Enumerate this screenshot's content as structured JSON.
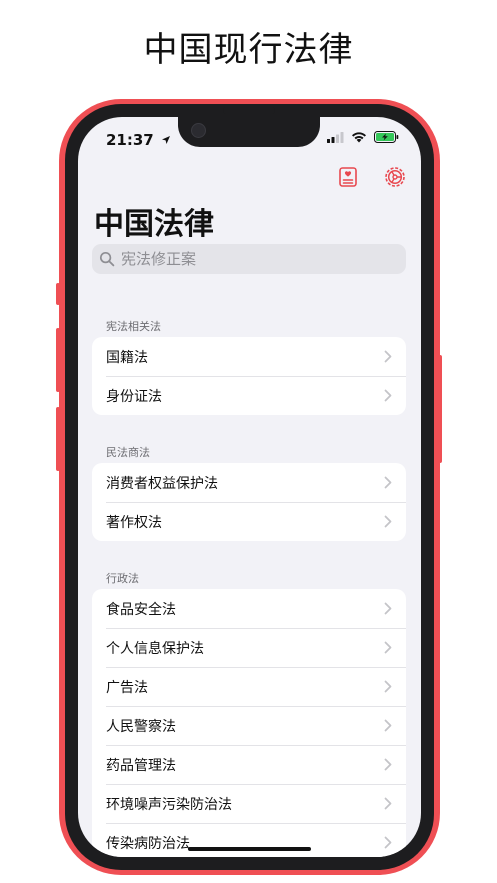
{
  "headline": "中国现行法律",
  "status_bar": {
    "time": "21:37"
  },
  "nav": {
    "title": "中国法律"
  },
  "search": {
    "placeholder": "宪法修正案"
  },
  "sections": [
    {
      "header": "宪法相关法",
      "items": [
        "国籍法",
        "身份证法"
      ]
    },
    {
      "header": "民法商法",
      "items": [
        "消费者权益保护法",
        "著作权法"
      ]
    },
    {
      "header": "行政法",
      "items": [
        "食品安全法",
        "个人信息保护法",
        "广告法",
        "人民警察法",
        "药品管理法",
        "环境噪声污染防治法",
        "传染病防治法"
      ]
    }
  ],
  "colors": {
    "accent": "#e8484f",
    "frame": "#ef4f54",
    "background": "#f2f2f7"
  }
}
